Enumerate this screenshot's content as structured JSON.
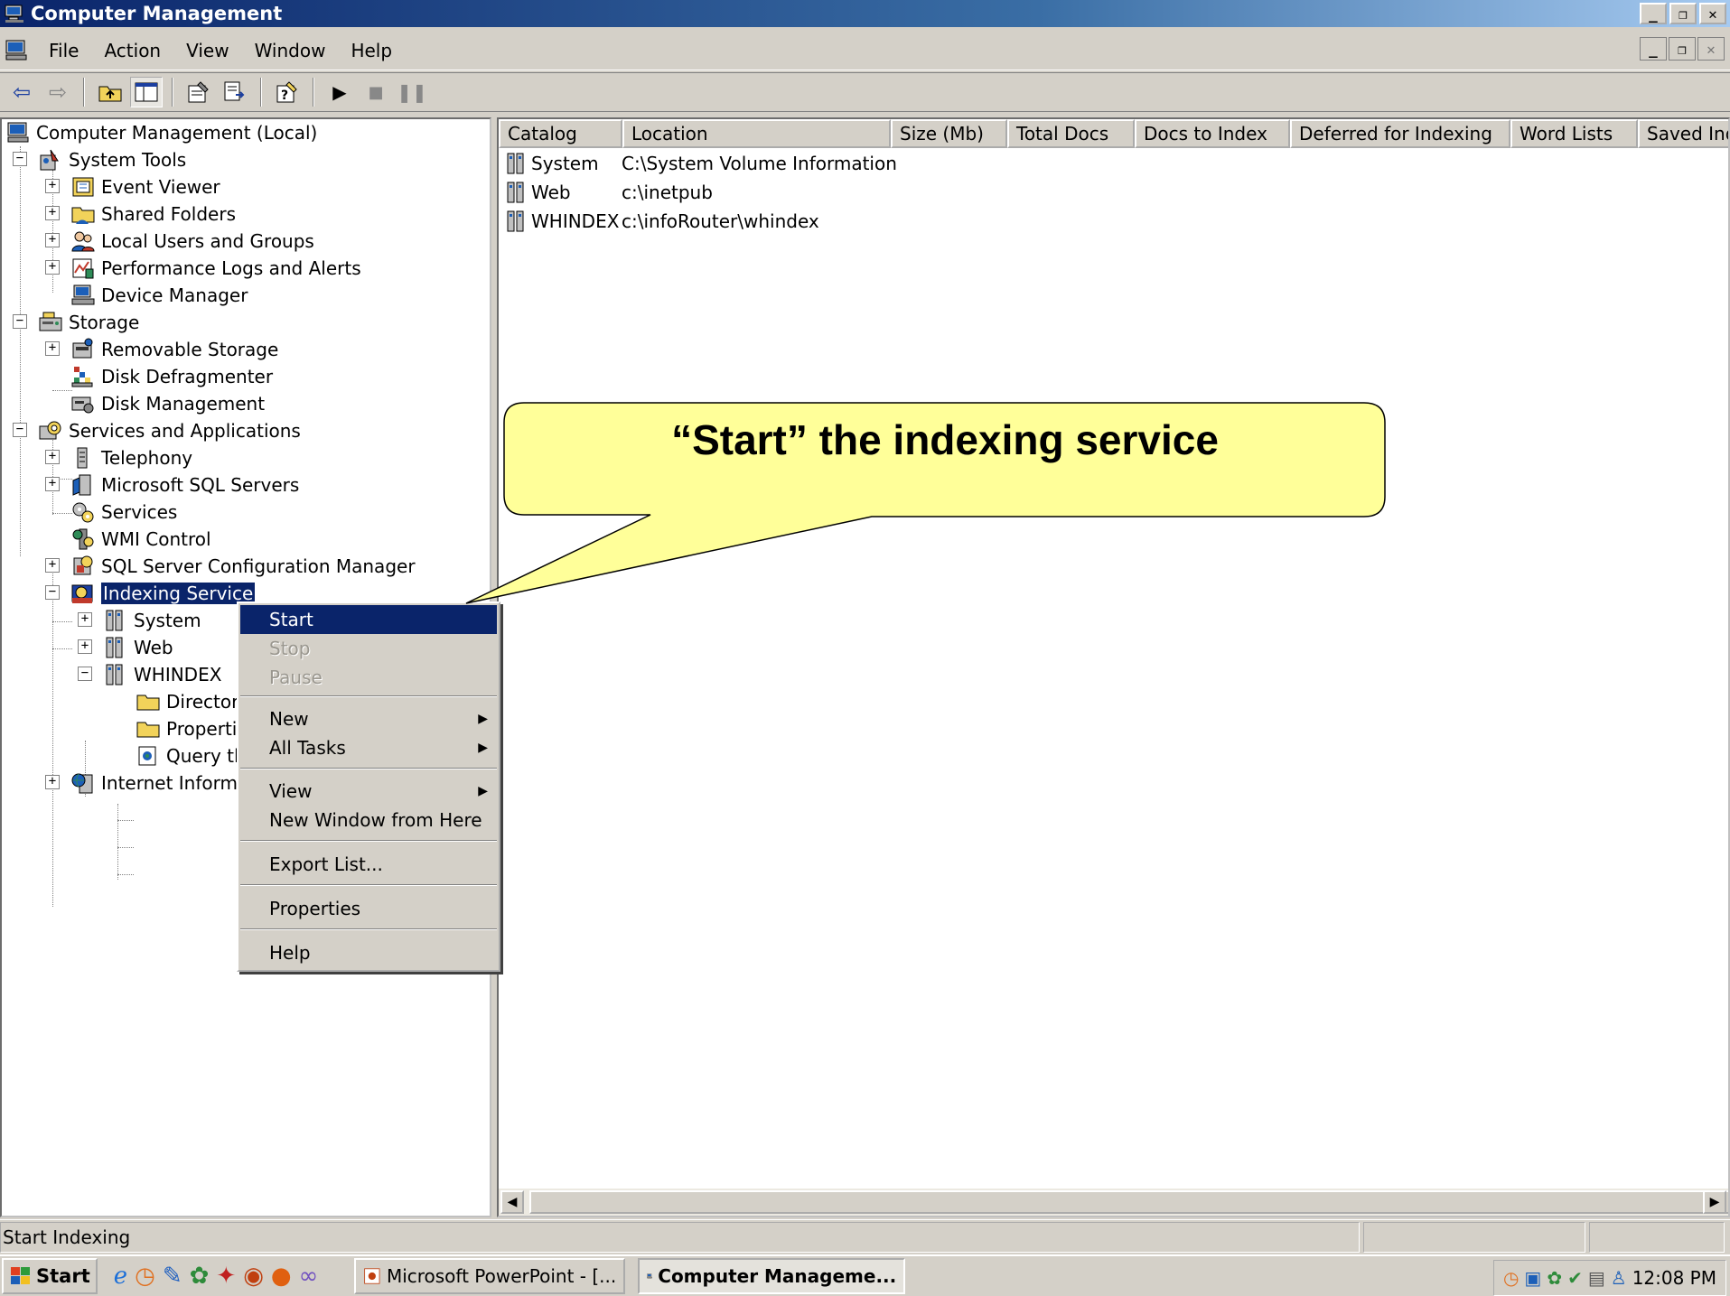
{
  "window": {
    "title": "Computer Management"
  },
  "menubar": {
    "items": [
      "File",
      "Action",
      "View",
      "Window",
      "Help"
    ]
  },
  "tree": {
    "root": "Computer Management (Local)",
    "system_tools": "System Tools",
    "event_viewer": "Event Viewer",
    "shared_folders": "Shared Folders",
    "local_users": "Local Users and Groups",
    "perf_logs": "Performance Logs and Alerts",
    "device_manager": "Device Manager",
    "storage": "Storage",
    "removable_storage": "Removable Storage",
    "disk_defrag": "Disk Defragmenter",
    "disk_mgmt": "Disk Management",
    "services_apps": "Services and Applications",
    "telephony": "Telephony",
    "sql_servers": "Microsoft SQL Servers",
    "services": "Services",
    "wmi": "WMI Control",
    "sql_config": "SQL Server Configuration Manager",
    "indexing": "Indexing Service",
    "idx_system": "System",
    "idx_web": "Web",
    "idx_whindex": "WHINDEX",
    "directories": "Director",
    "properties": "Properti",
    "query": "Query tl",
    "iis": "Internet Inform"
  },
  "list": {
    "columns": [
      "Catalog",
      "Location",
      "Size (Mb)",
      "Total Docs",
      "Docs to Index",
      "Deferred for Indexing",
      "Word Lists",
      "Saved Ind"
    ],
    "rows": [
      {
        "catalog": "System",
        "location": "C:\\System Volume Information"
      },
      {
        "catalog": "Web",
        "location": "c:\\inetpub"
      },
      {
        "catalog": "WHINDEX",
        "location": "c:\\infoRouter\\whindex"
      }
    ]
  },
  "context_menu": {
    "start": "Start",
    "stop": "Stop",
    "pause": "Pause",
    "new": "New",
    "all_tasks": "All Tasks",
    "view": "View",
    "new_window": "New Window from Here",
    "export": "Export List...",
    "properties": "Properties",
    "help": "Help"
  },
  "callout": {
    "text": "“Start”  the indexing service"
  },
  "status": {
    "text": "Start Indexing"
  },
  "taskbar": {
    "start": "Start",
    "powerpoint": "Microsoft PowerPoint - [...",
    "compmgmt": "Computer Manageme...",
    "clock": "12:08 PM"
  },
  "colors": {
    "selection": "#0a246a",
    "callout_fill": "#ffff99",
    "face": "#d4d0c8"
  }
}
